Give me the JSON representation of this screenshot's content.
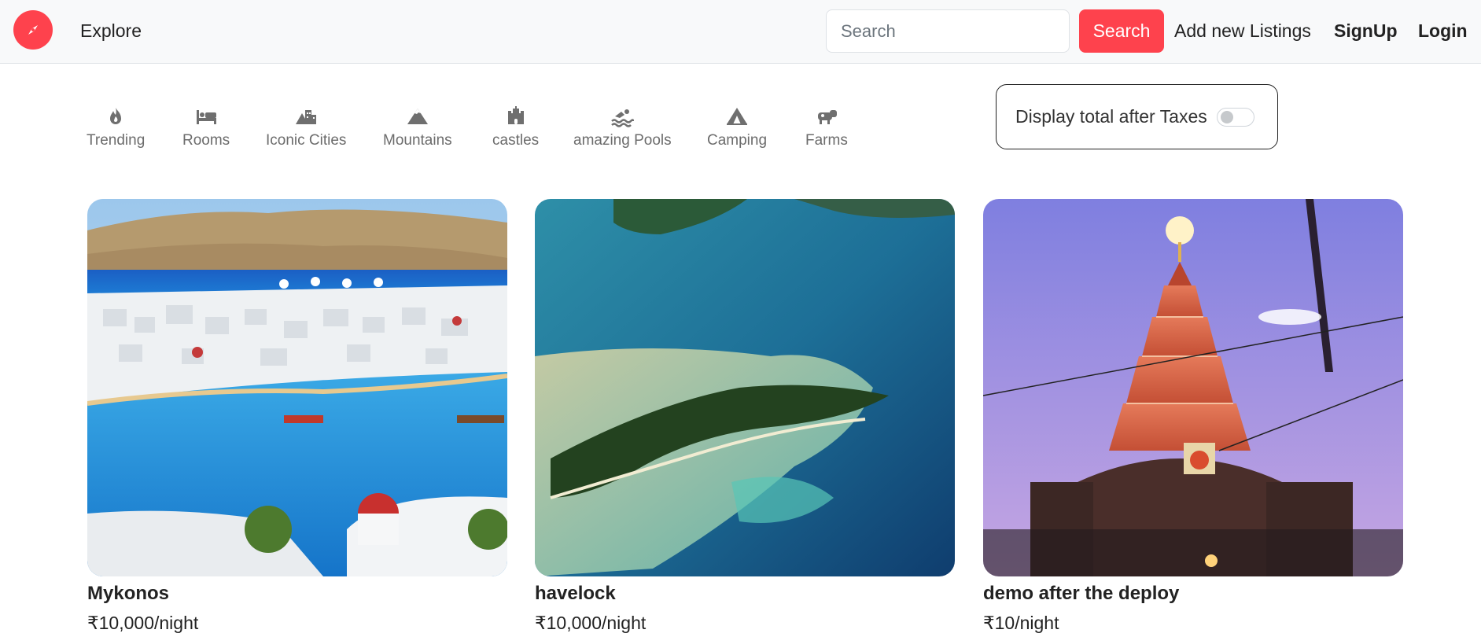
{
  "navbar": {
    "logo_icon": "compass-icon",
    "brand_color": "#fe424d",
    "explore_label": "Explore",
    "search_placeholder": "Search",
    "search_button": "Search",
    "add_listing": "Add new Listings",
    "signup": "SignUp",
    "login": "Login"
  },
  "filters": [
    {
      "label": "Trending",
      "icon": "fire-icon"
    },
    {
      "label": "Rooms",
      "icon": "bed-icon"
    },
    {
      "label": "Iconic Cities",
      "icon": "city-icon"
    },
    {
      "label": "Mountains",
      "icon": "mountain-icon"
    },
    {
      "label": "castles",
      "icon": "castle-icon"
    },
    {
      "label": "amazing Pools",
      "icon": "swimmer-icon"
    },
    {
      "label": "Camping",
      "icon": "tent-icon"
    },
    {
      "label": "Farms",
      "icon": "cow-icon"
    }
  ],
  "tax_toggle": {
    "label": "Display total after Taxes",
    "enabled": false
  },
  "listings": [
    {
      "title": "Mykonos",
      "price": "₹10,000/night",
      "image": "Greek island harbor with white houses and windmills"
    },
    {
      "title": "havelock",
      "price": "₹10,000/night",
      "image": "Aerial view of tropical island with turquoise reef"
    },
    {
      "title": "demo after the deploy",
      "price": "₹10/night",
      "image": "Illuminated temple tower at dusk"
    }
  ]
}
